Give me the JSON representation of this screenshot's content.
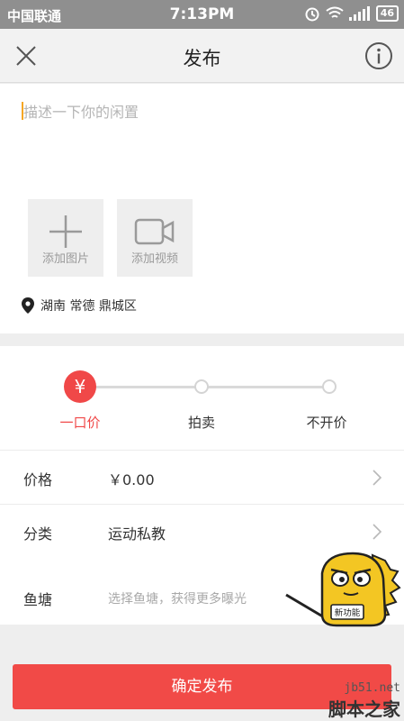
{
  "status": {
    "carrier": "中国联通",
    "time": "7:13PM",
    "battery": "46"
  },
  "nav": {
    "title": "发布",
    "close_icon": "close-icon",
    "info_icon": "info-icon"
  },
  "compose": {
    "placeholder": "描述一下你的闲置",
    "add_photo": "添加图片",
    "add_video": "添加视频",
    "location": "湖南 常德 鼎城区"
  },
  "pricing": {
    "options": [
      "一口价",
      "拍卖",
      "不开价"
    ],
    "selected_index": 0,
    "selected_symbol": "¥"
  },
  "rows": {
    "price": {
      "label": "价格",
      "value": "￥0.00"
    },
    "category": {
      "label": "分类",
      "value": "运动私教"
    }
  },
  "pond": {
    "label": "鱼塘",
    "hint": "选择鱼塘，获得更多曝光",
    "badge": "新功能"
  },
  "submit": {
    "label": "确定发布"
  },
  "watermark": {
    "url": "jb51.net",
    "site": "脚本之家"
  },
  "colors": {
    "accent": "#f04848",
    "submit": "#f14a47",
    "cursor": "#f5a623"
  }
}
